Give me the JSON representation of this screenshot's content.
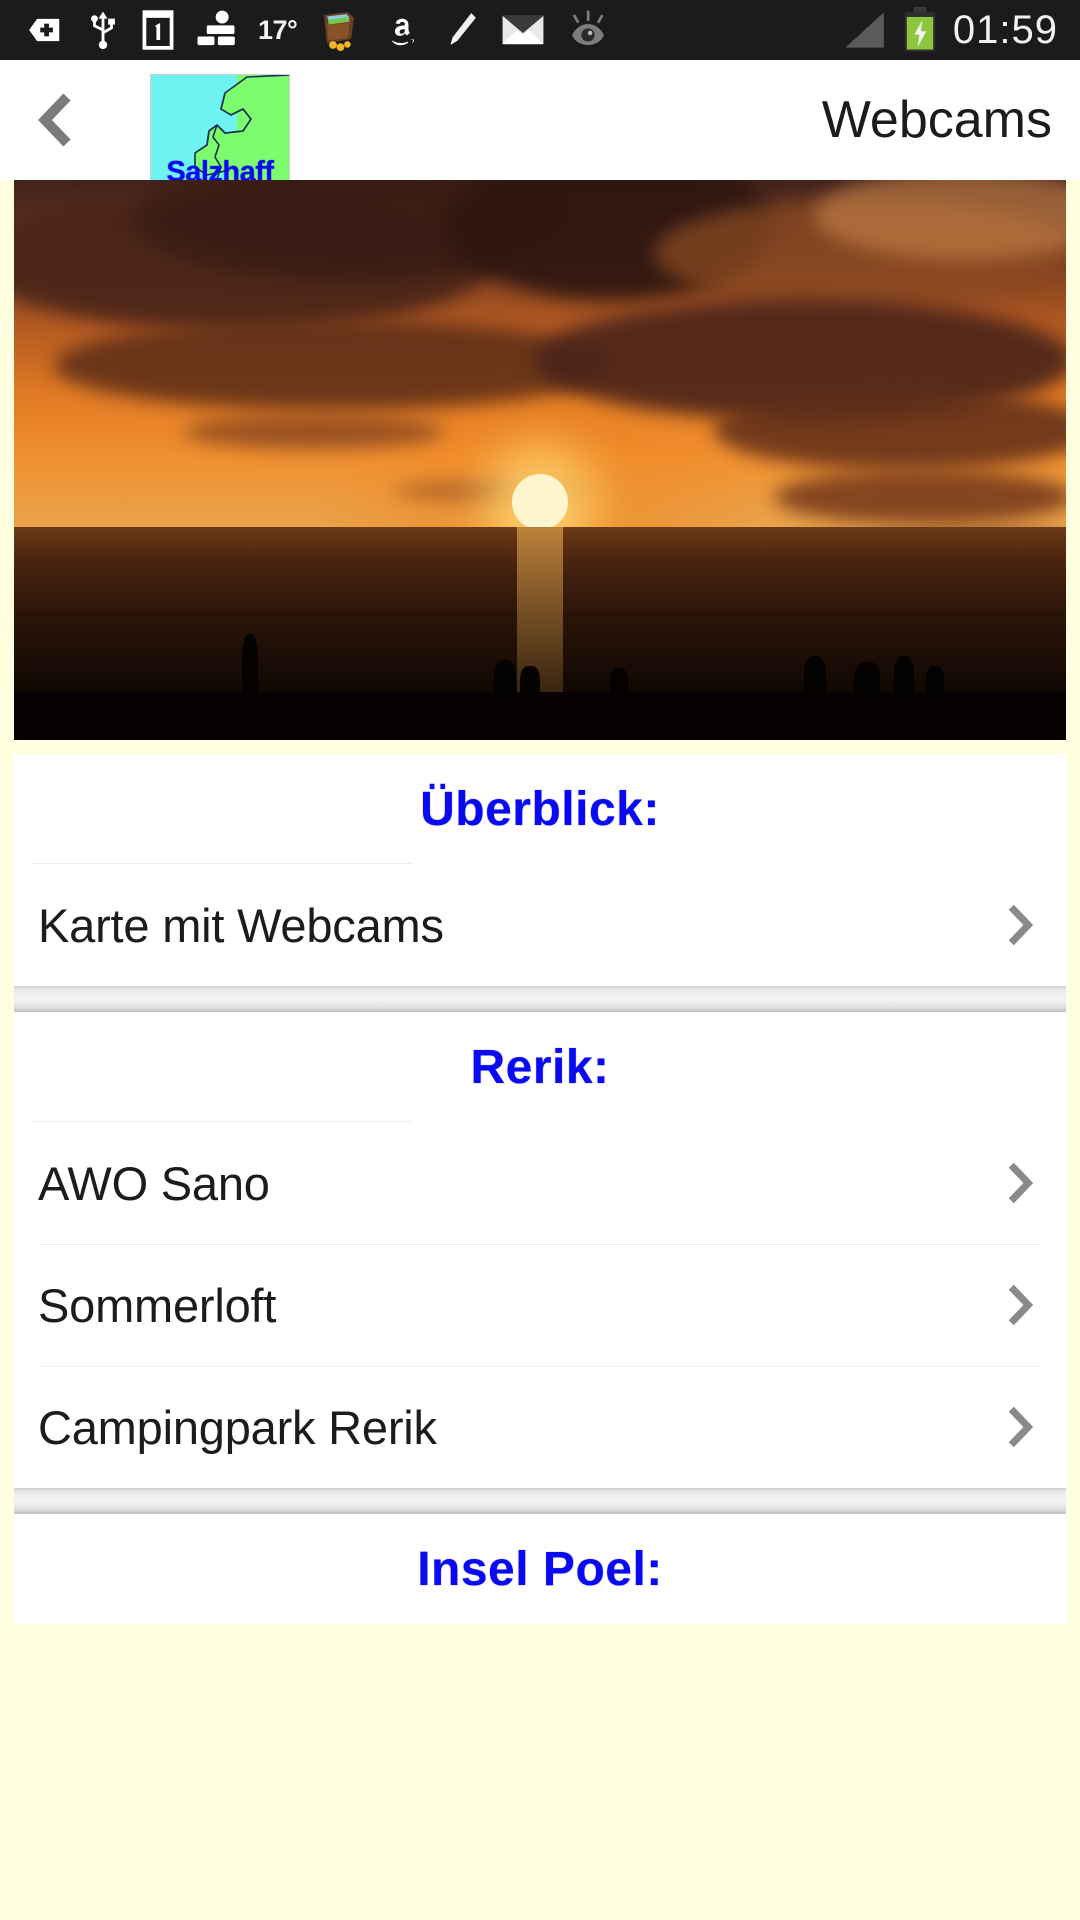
{
  "statusbar": {
    "icons_left": [
      {
        "name": "bookmark-plus-icon",
        "label": "bookmark-plus"
      },
      {
        "name": "usb-icon",
        "label": "usb"
      },
      {
        "name": "sim-card-1-icon",
        "label": "sim-1"
      },
      {
        "name": "person-share-icon",
        "label": "person-share"
      }
    ],
    "temperature": "17°",
    "icons_middle": [
      {
        "name": "wallet-app-icon",
        "label": "wallet"
      },
      {
        "name": "amazon-icon",
        "label": "amazon"
      },
      {
        "name": "pencil-edit-icon",
        "label": "edit"
      },
      {
        "name": "mail-envelope-icon",
        "label": "mail"
      },
      {
        "name": "eye-icon",
        "label": "smart-stay"
      }
    ],
    "signal": "signal-bars-icon",
    "battery": "battery-charging-icon",
    "clock": "01:59"
  },
  "appbar": {
    "back_icon": "chevron-left-icon",
    "logo_text": "Salzhaff",
    "title": "Webcams"
  },
  "hero": {
    "alt": "Sonnenuntergang über der Ostsee"
  },
  "sections": [
    {
      "heading": "Überblick:",
      "items": [
        {
          "label": "Karte mit Webcams",
          "chevron": "chevron-right-icon"
        }
      ]
    },
    {
      "heading": "Rerik:",
      "items": [
        {
          "label": "AWO Sano",
          "chevron": "chevron-right-icon"
        },
        {
          "label": "Sommerloft",
          "chevron": "chevron-right-icon"
        },
        {
          "label": "Campingpark Rerik",
          "chevron": "chevron-right-icon"
        }
      ]
    },
    {
      "heading": "Insel Poel:",
      "items": []
    }
  ],
  "colors": {
    "page_background": "#ffffe0",
    "card_background": "#ffffff",
    "heading_blue": "#0a0af0",
    "statusbar_background": "#1b1b1b",
    "chevron_gray": "#8a8a8a",
    "logo_land": "#7cfc6e",
    "logo_sea": "#6ff2f2"
  }
}
